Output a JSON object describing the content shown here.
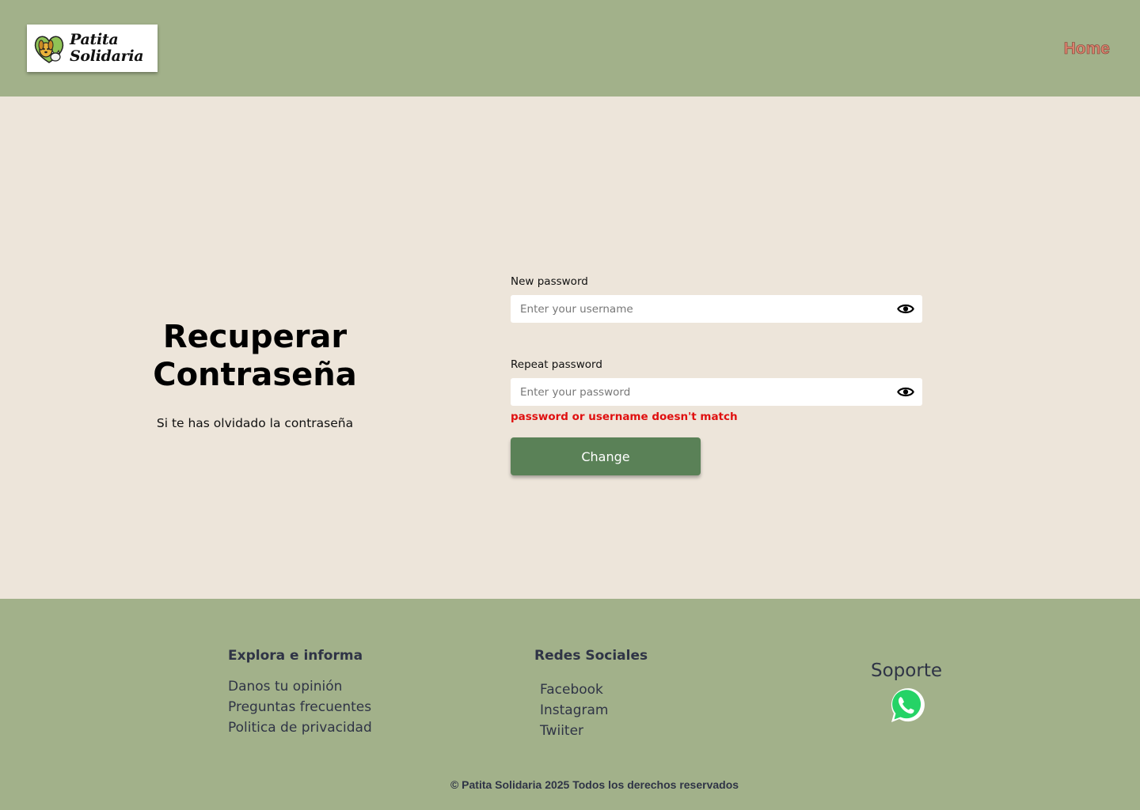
{
  "header": {
    "logo_line1": "Patita",
    "logo_line2": "Solidaria",
    "nav_home": "Home"
  },
  "intro": {
    "title_line1": "Recuperar",
    "title_line2": "Contraseña",
    "subtitle": "Si te has olvidado la contraseña"
  },
  "form": {
    "new_password_label": "New password",
    "new_password_placeholder": "Enter your username",
    "repeat_password_label": "Repeat password",
    "repeat_password_placeholder": "Enter your password",
    "error": "password or username doesn't match",
    "submit_label": "Change"
  },
  "footer": {
    "explore": {
      "title": "Explora e informa",
      "links": [
        "Danos tu opinión",
        "Preguntas frecuentes",
        "Politica de privacidad"
      ]
    },
    "social": {
      "title": "Redes Sociales",
      "links": [
        "Facebook",
        "Instagram",
        "Twiiter"
      ]
    },
    "support": {
      "title": "Soporte",
      "icon": "whatsapp-icon"
    },
    "copyright": "© Patita Solidaria 2025 Todos los derechos reservados"
  },
  "colors": {
    "header_bg": "#a2b18a",
    "page_bg": "#ede5da",
    "button_bg": "#5a8157",
    "error": "#e01010",
    "nav_link": "#d9826e",
    "footer_text": "#2f3446"
  }
}
